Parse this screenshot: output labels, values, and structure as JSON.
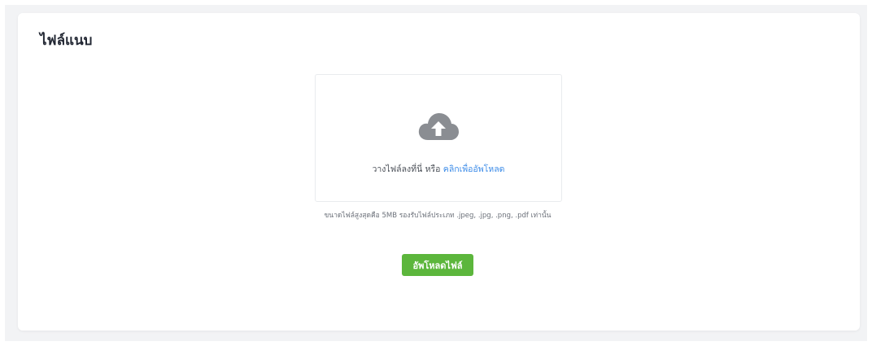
{
  "card": {
    "title": "ไฟล์แนบ"
  },
  "dropzone": {
    "text": "วางไฟล์ลงที่นี่ หรือ",
    "link_text": "คลิกเพื่ออัพโหลด",
    "icon": "cloud-upload-icon"
  },
  "hint": "ขนาดไฟล์สูงสุดคือ 5MB รองรับไฟล์ประเภท .jpeg, .jpg, .png, .pdf เท่านั้น",
  "upload_button": {
    "label": "อัพโหลดไฟล์"
  },
  "colors": {
    "accent_link": "#3b8be8",
    "button_green": "#5cb63c",
    "icon_gray": "#8a8d92"
  }
}
